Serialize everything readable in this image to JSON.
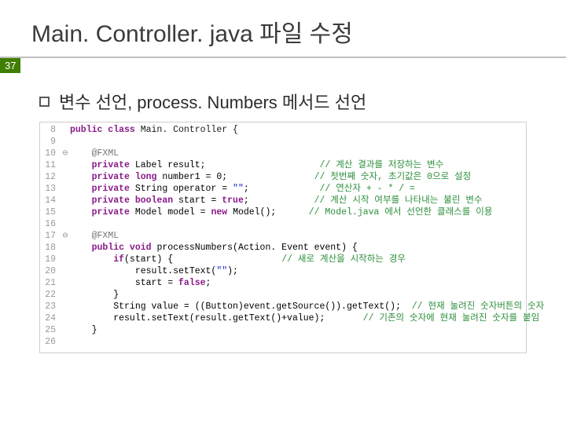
{
  "slide": {
    "title": "Main. Controller. java 파일 수정",
    "page_number": "37",
    "subheading": "변수 선언, process. Numbers 메서드 선언"
  },
  "code": {
    "lines": [
      {
        "ln": "8",
        "fold": " ",
        "segs": [
          {
            "t": "public class ",
            "c": "kw"
          },
          {
            "t": "Main. Controller {",
            "c": "cls"
          }
        ]
      },
      {
        "ln": "9",
        "fold": " ",
        "segs": []
      },
      {
        "ln": "10",
        "fold": "⊖",
        "segs": [
          {
            "t": "    ",
            "c": "body-text"
          },
          {
            "t": "@FXML",
            "c": "ann"
          }
        ]
      },
      {
        "ln": "11",
        "fold": " ",
        "segs": [
          {
            "t": "    ",
            "c": "body-text"
          },
          {
            "t": "private ",
            "c": "kw"
          },
          {
            "t": "Label result;",
            "c": "body-text"
          },
          {
            "t": "                     ",
            "c": "body-text"
          },
          {
            "t": "// 계산 결과를 저장하는 변수",
            "c": "cm"
          }
        ]
      },
      {
        "ln": "12",
        "fold": " ",
        "segs": [
          {
            "t": "    ",
            "c": "body-text"
          },
          {
            "t": "private long ",
            "c": "kw"
          },
          {
            "t": "number1 = 0;",
            "c": "body-text"
          },
          {
            "t": "                ",
            "c": "body-text"
          },
          {
            "t": "// 첫번째 숫자, 초기값은 0으로 설정",
            "c": "cm"
          }
        ]
      },
      {
        "ln": "13",
        "fold": " ",
        "segs": [
          {
            "t": "    ",
            "c": "body-text"
          },
          {
            "t": "private ",
            "c": "kw"
          },
          {
            "t": "String operator = ",
            "c": "body-text"
          },
          {
            "t": "\"\"",
            "c": "str"
          },
          {
            "t": ";",
            "c": "body-text"
          },
          {
            "t": "             ",
            "c": "body-text"
          },
          {
            "t": "// 연산자 + - * / =",
            "c": "cm"
          }
        ]
      },
      {
        "ln": "14",
        "fold": " ",
        "segs": [
          {
            "t": "    ",
            "c": "body-text"
          },
          {
            "t": "private boolean ",
            "c": "kw"
          },
          {
            "t": "start = ",
            "c": "body-text"
          },
          {
            "t": "true",
            "c": "kw"
          },
          {
            "t": ";",
            "c": "body-text"
          },
          {
            "t": "            ",
            "c": "body-text"
          },
          {
            "t": "// 계산 시작 여부를 나타내는 불린 변수",
            "c": "cm"
          }
        ]
      },
      {
        "ln": "15",
        "fold": " ",
        "segs": [
          {
            "t": "    ",
            "c": "body-text"
          },
          {
            "t": "private ",
            "c": "kw"
          },
          {
            "t": "Model model = ",
            "c": "body-text"
          },
          {
            "t": "new ",
            "c": "kw"
          },
          {
            "t": "Model();",
            "c": "body-text"
          },
          {
            "t": "      ",
            "c": "body-text"
          },
          {
            "t": "// Model.java 에서 선언한 클래스를 이용",
            "c": "cm"
          }
        ]
      },
      {
        "ln": "16",
        "fold": " ",
        "segs": []
      },
      {
        "ln": "17",
        "fold": "⊖",
        "segs": [
          {
            "t": "    ",
            "c": "body-text"
          },
          {
            "t": "@FXML",
            "c": "ann"
          }
        ]
      },
      {
        "ln": "18",
        "fold": " ",
        "segs": [
          {
            "t": "    ",
            "c": "body-text"
          },
          {
            "t": "public void ",
            "c": "kw"
          },
          {
            "t": "processNumbers(Action. Event event) {",
            "c": "body-text"
          }
        ]
      },
      {
        "ln": "19",
        "fold": " ",
        "segs": [
          {
            "t": "        ",
            "c": "body-text"
          },
          {
            "t": "if",
            "c": "kw"
          },
          {
            "t": "(start) {",
            "c": "body-text"
          },
          {
            "t": "                    ",
            "c": "body-text"
          },
          {
            "t": "// 새로 계산을 시작하는 경우",
            "c": "cm"
          }
        ]
      },
      {
        "ln": "20",
        "fold": " ",
        "segs": [
          {
            "t": "            result.setText(",
            "c": "body-text"
          },
          {
            "t": "\"\"",
            "c": "str"
          },
          {
            "t": ");",
            "c": "body-text"
          }
        ]
      },
      {
        "ln": "21",
        "fold": " ",
        "segs": [
          {
            "t": "            start = ",
            "c": "body-text"
          },
          {
            "t": "false",
            "c": "kw"
          },
          {
            "t": ";",
            "c": "body-text"
          }
        ]
      },
      {
        "ln": "22",
        "fold": " ",
        "segs": [
          {
            "t": "        }",
            "c": "body-text"
          }
        ]
      },
      {
        "ln": "23",
        "fold": " ",
        "segs": [
          {
            "t": "        String value = ((Button)event.getSource()).getText();",
            "c": "body-text"
          },
          {
            "t": "  ",
            "c": "body-text"
          },
          {
            "t": "// 현재 눌려진 숫자버튼의 숫자",
            "c": "cm"
          }
        ]
      },
      {
        "ln": "24",
        "fold": " ",
        "segs": [
          {
            "t": "        result.setText(result.getText()+value);",
            "c": "body-text"
          },
          {
            "t": "       ",
            "c": "body-text"
          },
          {
            "t": "// 기존의 숫자에 현재 눌려진 숫자를 붙임",
            "c": "cm"
          }
        ]
      },
      {
        "ln": "25",
        "fold": " ",
        "segs": [
          {
            "t": "    }",
            "c": "body-text"
          }
        ]
      },
      {
        "ln": "26",
        "fold": " ",
        "segs": []
      }
    ]
  }
}
